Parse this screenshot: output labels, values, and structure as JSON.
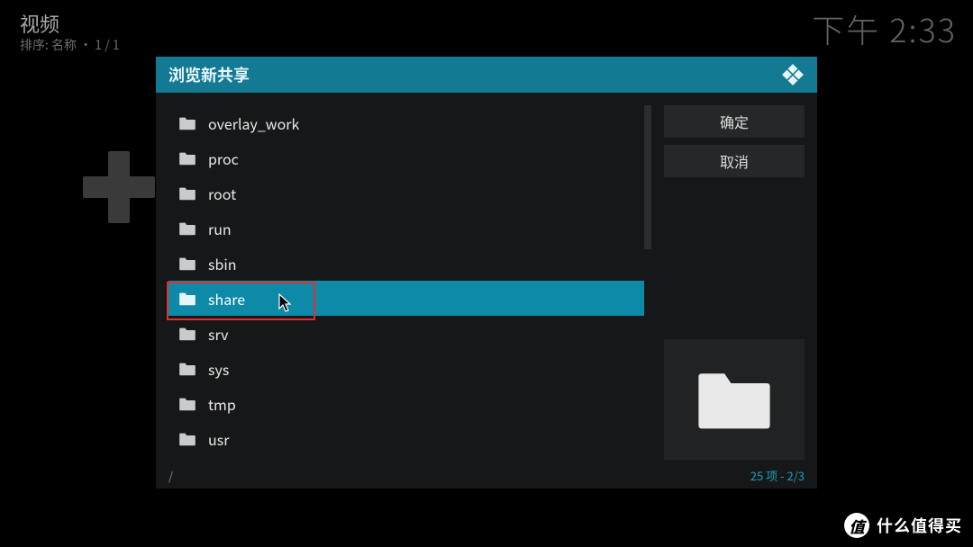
{
  "header": {
    "title": "视频",
    "sort": "排序: 名称  •  1 / 1"
  },
  "clock": "下午 2:33",
  "dialog": {
    "title": "浏览新共享",
    "folders": [
      {
        "name": "overlay_work",
        "selected": false
      },
      {
        "name": "proc",
        "selected": false
      },
      {
        "name": "root",
        "selected": false
      },
      {
        "name": "run",
        "selected": false
      },
      {
        "name": "sbin",
        "selected": false
      },
      {
        "name": "share",
        "selected": true
      },
      {
        "name": "srv",
        "selected": false
      },
      {
        "name": "sys",
        "selected": false
      },
      {
        "name": "tmp",
        "selected": false
      },
      {
        "name": "usr",
        "selected": false
      }
    ],
    "buttons": {
      "ok": "确定",
      "cancel": "取消"
    },
    "path": "/",
    "count_text": "25 项 - 2/3",
    "total_items": 25,
    "page": 2,
    "total_pages": 3
  },
  "watermark": {
    "badge": "值",
    "text": "什么值得买"
  }
}
